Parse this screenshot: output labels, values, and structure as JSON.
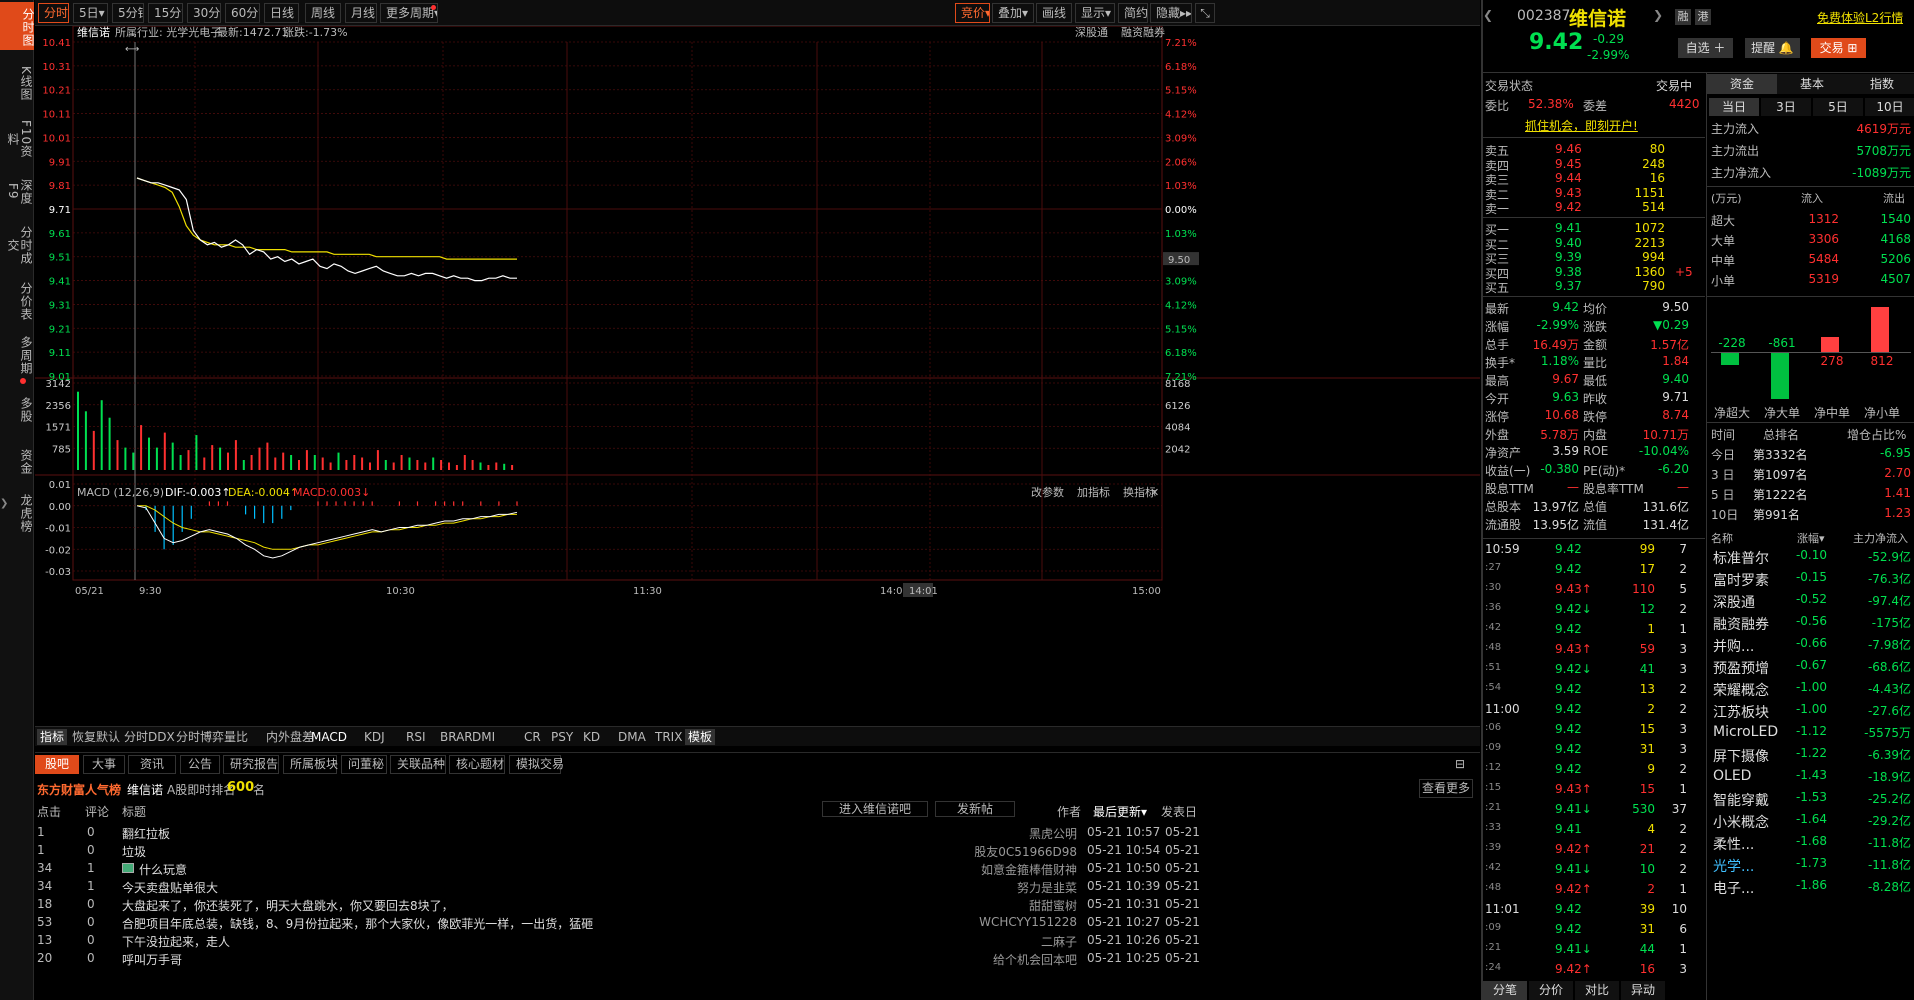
{
  "nav_left": [
    "分时图",
    "K线图",
    "F10资料",
    "深度F9",
    "分时成交",
    "分价表",
    "多周期",
    "多股",
    "资金",
    "龙虎榜"
  ],
  "toolbar": {
    "periods": [
      "分时",
      "5日▾",
      "5分钟",
      "15分钟",
      "30分钟",
      "60分钟",
      "日线",
      "周线",
      "月线",
      "更多周期▾"
    ],
    "right": [
      "竞价▾",
      "叠加▾",
      "画线",
      "显示▾",
      "简约",
      "隐藏▸▸"
    ],
    "collapse_icon": "⤡"
  },
  "header": {
    "stock": "维信诺",
    "industry": "所属行业: 光学光电子",
    "latest": "最新:1472.71",
    "change": "涨跌:-1.73%",
    "right1": "深股通",
    "right2": "融资融券"
  },
  "axis_left": [
    "10.41",
    "10.31",
    "10.21",
    "10.11",
    "10.01",
    "9.91",
    "9.81",
    "9.71",
    "9.61",
    "9.51",
    "9.41",
    "9.31",
    "9.21",
    "9.11",
    "9.01"
  ],
  "axis_right": [
    "7.21%",
    "6.18%",
    "5.15%",
    "4.12%",
    "3.09%",
    "2.06%",
    "1.03%",
    "0.00%",
    "1.03%",
    "2.06%",
    "3.09%",
    "4.12%",
    "5.15%",
    "6.18%",
    "7.21%"
  ],
  "price_marker": "9.50",
  "vol_left": [
    "3142",
    "2356",
    "1571",
    "785"
  ],
  "vol_right": [
    "8168",
    "6126",
    "4084",
    "2042"
  ],
  "macd": {
    "label": "MACD (12,26,9)",
    "dif": "DIF:-0.003↑",
    "dea": "DEA:-0.004↑",
    "macd": "MACD:0.003↓",
    "axis": [
      "0.01",
      "0.00",
      "-0.01",
      "-0.02",
      "-0.03"
    ],
    "tools": [
      "改参数",
      "加指标",
      "换指标"
    ],
    "close_icon": "✕"
  },
  "time_axis": [
    "05/21",
    "9:30",
    "10:30",
    "11:30",
    "14:00",
    "14:01",
    "15:00"
  ],
  "indicators": [
    "指标",
    "恢复默认",
    "分时DDX",
    "分时博弈",
    "量比",
    "内外盘差",
    "MACD",
    "KDJ",
    "RSI",
    "BRAR",
    "DMI",
    "CR",
    "PSY",
    "KD",
    "DMA",
    "TRIX",
    "模板"
  ],
  "bottom": {
    "tabs": [
      "股吧",
      "大事",
      "资讯",
      "公告",
      "研究报告",
      "所属板块",
      "问董秘",
      "关联品种",
      "核心题材",
      "模拟交易"
    ],
    "brand": "东方财富人气榜",
    "stock": "维信诺",
    "rank_label": "A股即时排名",
    "rank": "600",
    "rank_unit": "名",
    "more": "查看更多",
    "btn_enter": "进入维信诺吧",
    "btn_post": "发新帖",
    "cols": [
      "点击",
      "评论",
      "标题",
      "作者",
      "最后更新▾",
      "发表日"
    ],
    "rows": [
      [
        "1",
        "0",
        "翻红拉板",
        "黑虎公明",
        "05-21 10:57",
        "05-21"
      ],
      [
        "1",
        "0",
        "垃圾",
        "股友0C51966D98",
        "05-21 10:54",
        "05-21"
      ],
      [
        "34",
        "1",
        "什么玩意",
        "如意金箍棒借财神",
        "05-21 10:50",
        "05-21"
      ],
      [
        "34",
        "1",
        "今天卖盘贴单很大",
        "努力是韭菜",
        "05-21 10:39",
        "05-21"
      ],
      [
        "18",
        "0",
        "大盘起来了，你还装死了，明天大盘跳水，你又要回去8块了，",
        "甜甜蜜树",
        "05-21 10:31",
        "05-21"
      ],
      [
        "53",
        "0",
        "合肥项目年底总装，缺钱，8、9月份拉起来，那个大家伙，像欧菲光一样，一出货，猛砸",
        "WCHCYY151228",
        "05-21 10:27",
        "05-21"
      ],
      [
        "13",
        "0",
        "下午没拉起来，走人",
        "二麻子",
        "05-21 10:26",
        "05-21"
      ],
      [
        "20",
        "0",
        "呼叫万手哥",
        "给个机会回本吧",
        "05-21 10:25",
        "05-21"
      ]
    ]
  },
  "rp": {
    "code": "002387",
    "name": "维信诺",
    "price": "9.42",
    "chg": "-0.29",
    "pct": "-2.99%",
    "badges": [
      "融",
      "港"
    ],
    "trial": "免费体验L2行情",
    "btn_self": "自选 ＋",
    "btn_alert": "提醒 🔔",
    "btn_trade": "交易 ⊞",
    "status_label": "交易状态",
    "status": "交易中",
    "weibi_l": "委比",
    "weibi": "52.38%",
    "weicha_l": "委差",
    "weicha": "4420",
    "ad": "抓住机会，即刻开户!",
    "sells": [
      [
        "卖五",
        "9.46",
        "80"
      ],
      [
        "卖四",
        "9.45",
        "248"
      ],
      [
        "卖三",
        "9.44",
        "16"
      ],
      [
        "卖二",
        "9.43",
        "1151"
      ],
      [
        "卖一",
        "9.42",
        "514"
      ]
    ],
    "buys": [
      [
        "买一",
        "9.41",
        "1072"
      ],
      [
        "买二",
        "9.40",
        "2213"
      ],
      [
        "买三",
        "9.39",
        "994"
      ],
      [
        "买四",
        "9.38",
        "1360",
        "+5"
      ],
      [
        "买五",
        "9.37",
        "790"
      ]
    ],
    "stats": [
      [
        "最新",
        "9.42",
        "均价",
        "9.50"
      ],
      [
        "涨幅",
        "-2.99%",
        "涨跌",
        "▼0.29"
      ],
      [
        "总手",
        "16.49万",
        "金额",
        "1.57亿"
      ],
      [
        "换手*",
        "1.18%",
        "量比",
        "1.84"
      ],
      [
        "最高",
        "9.67",
        "最低",
        "9.40"
      ],
      [
        "今开",
        "9.63",
        "昨收",
        "9.71"
      ],
      [
        "涨停",
        "10.68",
        "跌停",
        "8.74"
      ],
      [
        "外盘",
        "5.78万",
        "内盘",
        "10.71万"
      ],
      [
        "净资产",
        "3.59",
        "ROE",
        "-10.04%"
      ],
      [
        "收益(一)",
        "-0.380",
        "PE(动)*",
        "-6.20"
      ],
      [
        "股息TTM",
        "—",
        "股息率TTM",
        "—"
      ],
      [
        "总股本",
        "13.97亿",
        "总值",
        "131.6亿"
      ],
      [
        "流通股",
        "13.95亿",
        "流值",
        "131.4亿"
      ]
    ],
    "ticks": [
      [
        "10:59",
        "9.42",
        "99",
        "7"
      ],
      [
        ":27",
        "9.42",
        "17",
        "2"
      ],
      [
        ":30",
        "9.43↑",
        "110",
        "5"
      ],
      [
        ":36",
        "9.42↓",
        "12",
        "2"
      ],
      [
        ":42",
        "9.42",
        "1",
        "1"
      ],
      [
        ":48",
        "9.43↑",
        "59",
        "3"
      ],
      [
        ":51",
        "9.42↓",
        "41",
        "3"
      ],
      [
        ":54",
        "9.42",
        "13",
        "2"
      ],
      [
        "11:00",
        "9.42",
        "2",
        "2"
      ],
      [
        ":06",
        "9.42",
        "15",
        "3"
      ],
      [
        ":09",
        "9.42",
        "31",
        "3"
      ],
      [
        ":12",
        "9.42",
        "9",
        "2"
      ],
      [
        ":15",
        "9.43↑",
        "15",
        "1"
      ],
      [
        ":21",
        "9.41↓",
        "530",
        "37"
      ],
      [
        ":33",
        "9.41",
        "4",
        "2"
      ],
      [
        ":39",
        "9.42↑",
        "21",
        "2"
      ],
      [
        ":42",
        "9.41↓",
        "10",
        "2"
      ],
      [
        ":48",
        "9.42↑",
        "2",
        "1"
      ],
      [
        "11:01",
        "9.42",
        "39",
        "10"
      ],
      [
        ":09",
        "9.42",
        "31",
        "6"
      ],
      [
        ":21",
        "9.41↓",
        "44",
        "1"
      ],
      [
        ":24",
        "9.42↑",
        "16",
        "3"
      ]
    ],
    "ticktabs": [
      "分笔",
      "分价",
      "对比",
      "异动"
    ],
    "fund_tabs": [
      "资金",
      "基本",
      "指数"
    ],
    "fund_sub": [
      "当日",
      "3日",
      "5日",
      "10日"
    ],
    "flows": [
      [
        "主力流入",
        "4619万元"
      ],
      [
        "主力流出",
        "5708万元"
      ],
      [
        "主力净流入",
        "-1089万元"
      ]
    ],
    "flow_head": [
      "(万元)",
      "流入",
      "流出"
    ],
    "flow_rows": [
      [
        "超大",
        "1312",
        "1540"
      ],
      [
        "大单",
        "3306",
        "4168"
      ],
      [
        "中单",
        "5484",
        "5206"
      ],
      [
        "小单",
        "5319",
        "4507"
      ]
    ],
    "net_bars": [
      {
        "label": "净超大",
        "value": -228
      },
      {
        "label": "净大单",
        "value": -861
      },
      {
        "label": "净中单",
        "value": 278
      },
      {
        "label": "净小单",
        "value": 812
      }
    ],
    "rank_head": [
      "时间",
      "总排名",
      "增仓占比%"
    ],
    "ranks": [
      [
        "今日",
        "第3332名",
        "-6.95"
      ],
      [
        "3 日",
        "第1097名",
        "2.70"
      ],
      [
        "5 日",
        "第1222名",
        "1.41"
      ],
      [
        "10日",
        "第991名",
        "1.23"
      ]
    ],
    "sect_head": [
      "名称",
      "涨幅▾",
      "主力净流入"
    ],
    "sectors": [
      [
        "标准普尔",
        "-0.10",
        "-52.9亿"
      ],
      [
        "富时罗素",
        "-0.15",
        "-76.3亿"
      ],
      [
        "深股通",
        "-0.52",
        "-97.4亿"
      ],
      [
        "融资融券",
        "-0.56",
        "-175亿"
      ],
      [
        "并购...",
        "-0.66",
        "-7.98亿"
      ],
      [
        "预盈预增",
        "-0.67",
        "-68.6亿"
      ],
      [
        "荣耀概念",
        "-1.00",
        "-4.43亿"
      ],
      [
        "江苏板块",
        "-1.00",
        "-27.6亿"
      ],
      [
        "MicroLED",
        "-1.12",
        "-5575万"
      ],
      [
        "屏下摄像",
        "-1.22",
        "-6.39亿"
      ],
      [
        "OLED",
        "-1.43",
        "-18.9亿"
      ],
      [
        "智能穿戴",
        "-1.53",
        "-25.2亿"
      ],
      [
        "小米概念",
        "-1.64",
        "-29.2亿"
      ],
      [
        "柔性...",
        "-1.68",
        "-11.8亿"
      ],
      [
        "光学...",
        "-1.73",
        "-11.8亿"
      ],
      [
        "电子...",
        "-1.86",
        "-8.28亿"
      ]
    ]
  },
  "chart_data": {
    "type": "line",
    "title": "",
    "x_range": [
      "9:30",
      "15:00"
    ],
    "ylim": [
      9.01,
      10.41
    ],
    "prev_close": 9.71,
    "price": [
      9.84,
      9.83,
      9.82,
      9.82,
      9.81,
      9.8,
      9.79,
      9.75,
      9.62,
      9.58,
      9.56,
      9.57,
      9.55,
      9.56,
      9.58,
      9.56,
      9.52,
      9.54,
      9.53,
      9.5,
      9.51,
      9.49,
      9.5,
      9.48,
      9.49,
      9.5,
      9.47,
      9.46,
      9.48,
      9.47,
      9.45,
      9.44,
      9.45,
      9.46,
      9.47,
      9.45,
      9.44,
      9.43,
      9.43,
      9.44,
      9.43,
      9.44,
      9.44,
      9.43,
      9.42,
      9.43,
      9.42,
      9.42,
      9.41,
      9.41,
      9.42,
      9.42,
      9.43,
      9.42,
      9.42
    ],
    "avg": [
      9.84,
      9.83,
      9.82,
      9.81,
      9.8,
      9.78,
      9.72,
      9.64,
      9.6,
      9.58,
      9.57,
      9.56,
      9.56,
      9.56,
      9.55,
      9.55,
      9.55,
      9.54,
      9.54,
      9.54,
      9.54,
      9.54,
      9.53,
      9.53,
      9.53,
      9.53,
      9.53,
      9.53,
      9.52,
      9.52,
      9.52,
      9.52,
      9.52,
      9.52,
      9.51,
      9.51,
      9.51,
      9.51,
      9.51,
      9.51,
      9.51,
      9.51,
      9.51,
      9.51,
      9.5,
      9.5,
      9.5,
      9.5,
      9.5,
      9.5,
      9.5,
      9.5,
      9.5,
      9.5,
      9.5
    ],
    "volume_ylim": [
      0,
      3142
    ],
    "volume": [
      3142,
      2356,
      1571,
      2800,
      2100,
      1200,
      900,
      700,
      1800,
      1300,
      900,
      1500,
      1100,
      600,
      800,
      1400,
      500,
      1000,
      900,
      700,
      1200,
      400,
      600,
      900,
      1100,
      500,
      700,
      600,
      400,
      800,
      600,
      500,
      300,
      700,
      400,
      600,
      500,
      300,
      800,
      400,
      300,
      600,
      500,
      400,
      300,
      500,
      400,
      300,
      200,
      600,
      400,
      300,
      200,
      300,
      250,
      200
    ],
    "macd_ylim": [
      -0.03,
      0.01
    ],
    "dif": [
      0.0,
      -0.001,
      -0.008,
      -0.015,
      -0.017,
      -0.016,
      -0.014,
      -0.012,
      -0.011,
      -0.012,
      -0.013,
      -0.015,
      -0.018,
      -0.02,
      -0.023,
      -0.024,
      -0.023,
      -0.021,
      -0.019,
      -0.018,
      -0.017,
      -0.016,
      -0.015,
      -0.014,
      -0.013,
      -0.012,
      -0.011,
      -0.012,
      -0.011,
      -0.01,
      -0.01,
      -0.009,
      -0.009,
      -0.008,
      -0.007,
      -0.007,
      -0.006,
      -0.006,
      -0.005,
      -0.005,
      -0.004,
      -0.004,
      -0.003
    ],
    "dea": [
      0.0,
      0.0,
      -0.002,
      -0.005,
      -0.008,
      -0.01,
      -0.011,
      -0.012,
      -0.012,
      -0.013,
      -0.014,
      -0.015,
      -0.016,
      -0.017,
      -0.019,
      -0.02,
      -0.02,
      -0.02,
      -0.019,
      -0.018,
      -0.018,
      -0.017,
      -0.016,
      -0.015,
      -0.014,
      -0.013,
      -0.012,
      -0.012,
      -0.011,
      -0.011,
      -0.01,
      -0.01,
      -0.009,
      -0.009,
      -0.008,
      -0.008,
      -0.007,
      -0.006,
      -0.006,
      -0.005,
      -0.005,
      -0.004,
      -0.004
    ]
  }
}
